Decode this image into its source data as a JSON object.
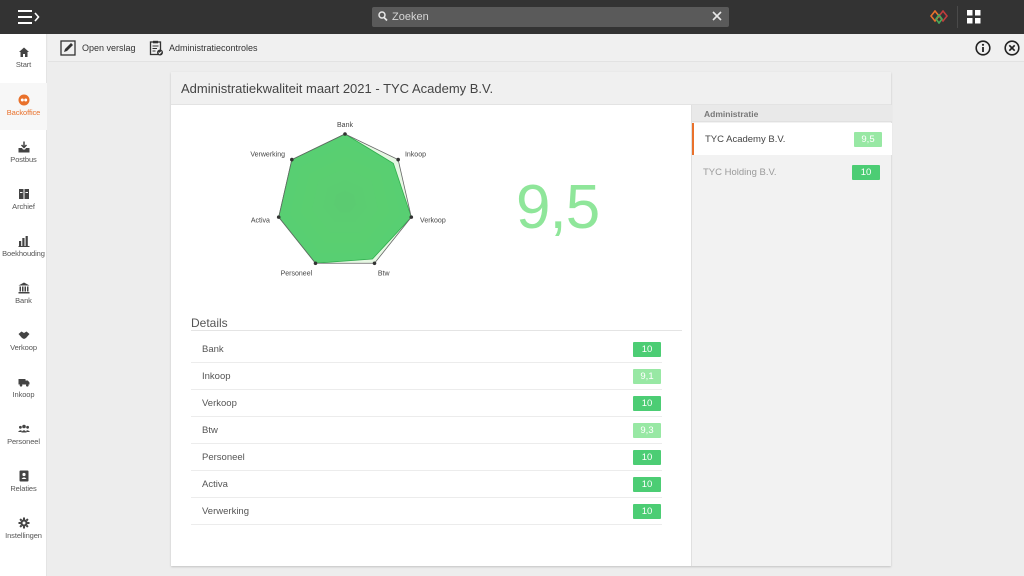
{
  "topbar": {
    "search_placeholder": "Zoeken",
    "menu_icon": "hamburger-chevron-icon",
    "brand_icon": "brand-diamond-logo",
    "apps_icon": "grid-apps-icon"
  },
  "sidebar": {
    "items": [
      {
        "label": "Start",
        "icon": "home-icon"
      },
      {
        "label": "Backoffice",
        "icon": "backoffice-icon",
        "active": true
      },
      {
        "label": "Postbus",
        "icon": "inbox-icon"
      },
      {
        "label": "Archief",
        "icon": "archive-icon"
      },
      {
        "label": "Boekhouding",
        "icon": "bar-chart-icon"
      },
      {
        "label": "Bank",
        "icon": "bank-icon"
      },
      {
        "label": "Verkoop",
        "icon": "handshake-icon"
      },
      {
        "label": "Inkoop",
        "icon": "truck-icon"
      },
      {
        "label": "Personeel",
        "icon": "people-icon"
      },
      {
        "label": "Relaties",
        "icon": "contact-card-icon"
      },
      {
        "label": "Instellingen",
        "icon": "gear-icon"
      }
    ]
  },
  "toolbar": {
    "open_report": "Open verslag",
    "admin_checks": "Administratiecontroles"
  },
  "card": {
    "title": "Administratiekwaliteit maart 2021 - TYC Academy B.V.",
    "score": "9,5",
    "details_title": "Details",
    "details": [
      {
        "name": "Bank",
        "score": "10",
        "shade": "dark"
      },
      {
        "name": "Inkoop",
        "score": "9,1",
        "shade": "light"
      },
      {
        "name": "Verkoop",
        "score": "10",
        "shade": "dark"
      },
      {
        "name": "Btw",
        "score": "9,3",
        "shade": "light"
      },
      {
        "name": "Personeel",
        "score": "10",
        "shade": "dark"
      },
      {
        "name": "Activa",
        "score": "10",
        "shade": "dark"
      },
      {
        "name": "Verwerking",
        "score": "10",
        "shade": "dark"
      }
    ]
  },
  "admin": {
    "header": "Administratie",
    "items": [
      {
        "name": "TYC Academy B.V.",
        "score": "9,5",
        "active": true,
        "shade": "light"
      },
      {
        "name": "TYC Holding B.V.",
        "score": "10",
        "active": false,
        "shade": "dark"
      }
    ]
  },
  "chart_data": {
    "type": "radar",
    "categories": [
      "Bank",
      "Inkoop",
      "Verkoop",
      "Btw",
      "Personeel",
      "Activa",
      "Verwerking"
    ],
    "values": [
      10,
      9.1,
      10,
      9.3,
      10,
      10,
      10
    ],
    "ylim": [
      0,
      10
    ]
  },
  "colors": {
    "accent": "#e9712b",
    "score_dark": "#4ccd74",
    "score_light": "#98e8a4",
    "topbar": "#333333"
  }
}
